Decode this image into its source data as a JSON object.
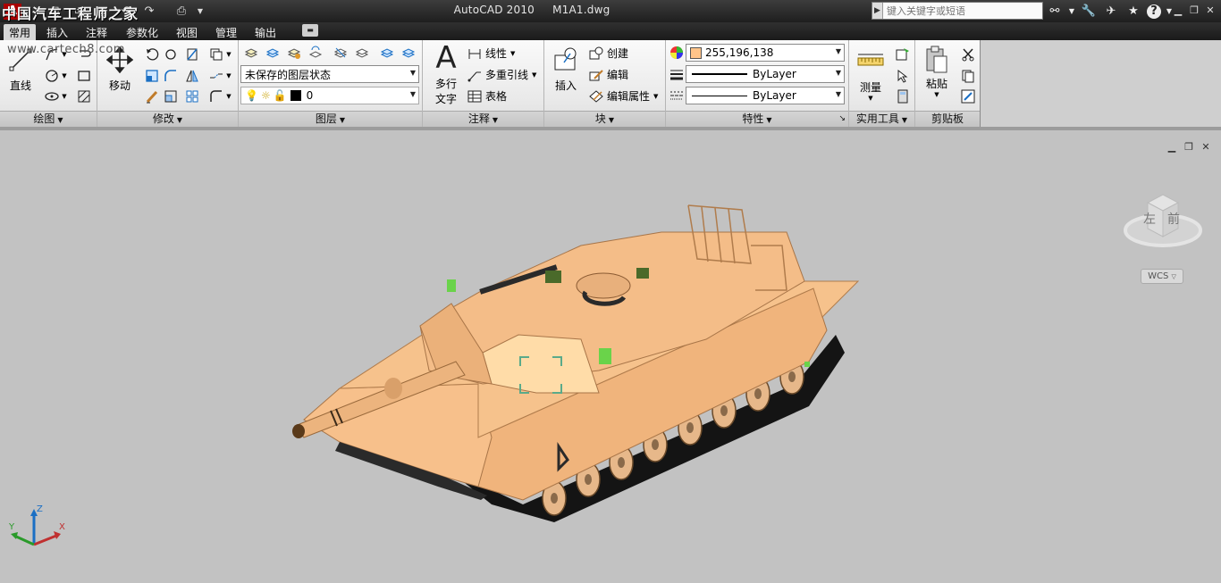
{
  "app": {
    "title": "AutoCAD 2010",
    "filename": "M1A1.dwg",
    "watermark_cn": "中国汽车工程师之家",
    "watermark_url": "www.cartech8.com"
  },
  "search": {
    "placeholder": "键入关键字或短语"
  },
  "tabs": [
    "常用",
    "插入",
    "注释",
    "参数化",
    "视图",
    "管理",
    "输出"
  ],
  "ribbon": {
    "draw": {
      "line_label": "直线",
      "footer": "绘图"
    },
    "modify": {
      "move_label": "移动",
      "footer": "修改"
    },
    "layers": {
      "state_value": "未保存的图层状态",
      "layer_value": "0",
      "footer": "图层"
    },
    "annotation": {
      "mtext_label": "多行",
      "mtext_label2": "文字",
      "linear_label": "线性",
      "mleader_label": "多重引线",
      "table_label": "表格",
      "footer": "注释"
    },
    "block": {
      "insert_label": "插入",
      "create_label": "创建",
      "edit_label": "编辑",
      "editattr_label": "编辑属性",
      "footer": "块"
    },
    "properties": {
      "color_value": "255,196,138",
      "linetype_value": "ByLayer",
      "lineweight_value": "ByLayer",
      "footer": "特性"
    },
    "utilities": {
      "measure_label": "测量",
      "footer": "实用工具"
    },
    "clipboard": {
      "paste_label": "粘贴",
      "footer": "剪贴板"
    }
  },
  "viewcube": {
    "left_face": "左",
    "front_face": "前"
  },
  "wcs_label": "WCS",
  "ucs": {
    "x": "X",
    "y": "Y",
    "z": "Z"
  },
  "colors": {
    "tank": "#ffc48a",
    "tank_shade": "#d9a06a",
    "tank_dark": "#b9844f",
    "titlebar": "#2a2a2a",
    "viewport": "#c2c2c2"
  }
}
